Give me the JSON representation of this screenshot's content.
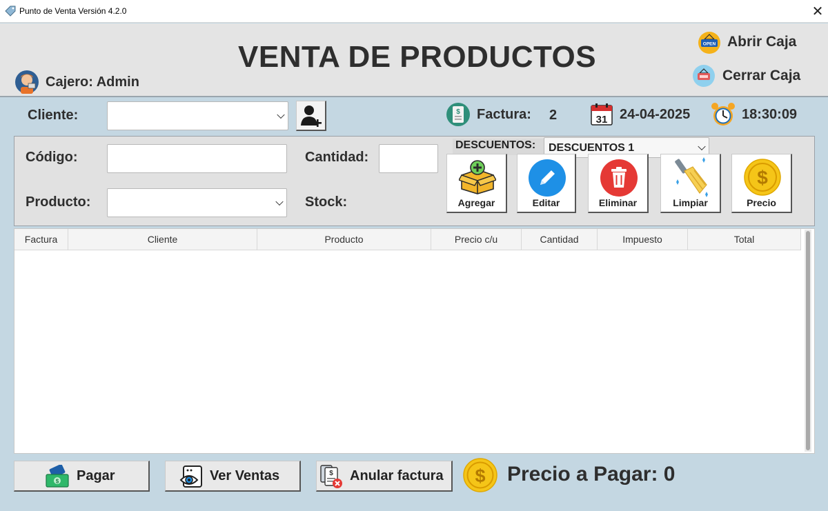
{
  "window": {
    "title": "Punto de Venta Versión 4.2.0",
    "close_glyph": "✕"
  },
  "header": {
    "title": "VENTA DE PRODUCTOS",
    "cashier_label": "Cajero: Admin",
    "open_register": "Abrir Caja",
    "close_register": "Cerrar Caja",
    "open_sign_text": "OPEN"
  },
  "info_bar": {
    "client_label": "Cliente:",
    "client_value": "",
    "invoice_label": "Factura:",
    "invoice_number": "2",
    "date": "24-04-2025",
    "time": "18:30:09",
    "calendar_day": "31"
  },
  "form": {
    "code_label": "Código:",
    "code_value": "",
    "quantity_label": "Cantidad:",
    "quantity_value": "",
    "product_label": "Producto:",
    "product_value": "",
    "stock_label": "Stock:",
    "discounts_label": "DESCUENTOS:",
    "discounts_selected": "DESCUENTOS 1"
  },
  "actions": {
    "add": "Agregar",
    "edit": "Editar",
    "delete": "Eliminar",
    "clear": "Limpiar",
    "price": "Precio"
  },
  "table": {
    "columns": [
      "Factura",
      "Cliente",
      "Producto",
      "Precio c/u",
      "Cantidad",
      "Impuesto",
      "Total"
    ],
    "rows": []
  },
  "footer": {
    "pay": "Pagar",
    "view_sales": "Ver Ventas",
    "void_invoice": "Anular factura",
    "total_to_pay": "Precio a Pagar: 0"
  },
  "icons": {
    "app": "price-tag-icon",
    "cashier": "cashier-avatar-icon",
    "open": "open-sign-icon",
    "close": "closed-sign-icon",
    "add_client": "add-user-icon",
    "invoice": "receipt-icon",
    "date": "calendar-icon",
    "time": "alarm-clock-icon",
    "add": "box-plus-icon",
    "edit": "pencil-icon",
    "delete": "trash-icon",
    "clear": "broom-icon",
    "price": "dollar-coin-icon",
    "pay": "money-icon",
    "view_sales": "eye-document-icon",
    "void": "void-invoice-icon",
    "total": "dollar-coin-icon"
  },
  "colors": {
    "background": "#c4d7e2",
    "header": "#e4e4e4",
    "edit_blue": "#1e90e6",
    "delete_red": "#e53935",
    "coin_gold": "#f5c518"
  }
}
